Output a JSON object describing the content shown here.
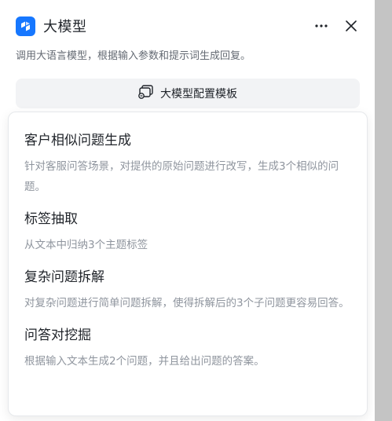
{
  "header": {
    "title": "大模型",
    "subtitle": "调用大语言模型，根据输入参数和提示词生成回复。",
    "brand_color": "#1677ff"
  },
  "template_button": {
    "label": "大模型配置模板"
  },
  "templates": [
    {
      "title": "客户相似问题生成",
      "description": "针对客服问答场景，对提供的原始问题进行改写，生成3个相似的问题。"
    },
    {
      "title": "标签抽取",
      "description": "从文本中归纳3个主题标签"
    },
    {
      "title": "复杂问题拆解",
      "description": "对复杂问题进行简单问题拆解，使得拆解后的3个子问题更容易回答。"
    },
    {
      "title": "问答对挖掘",
      "description": "根据输入文本生成2个问题，并且给出问题的答案。"
    }
  ]
}
